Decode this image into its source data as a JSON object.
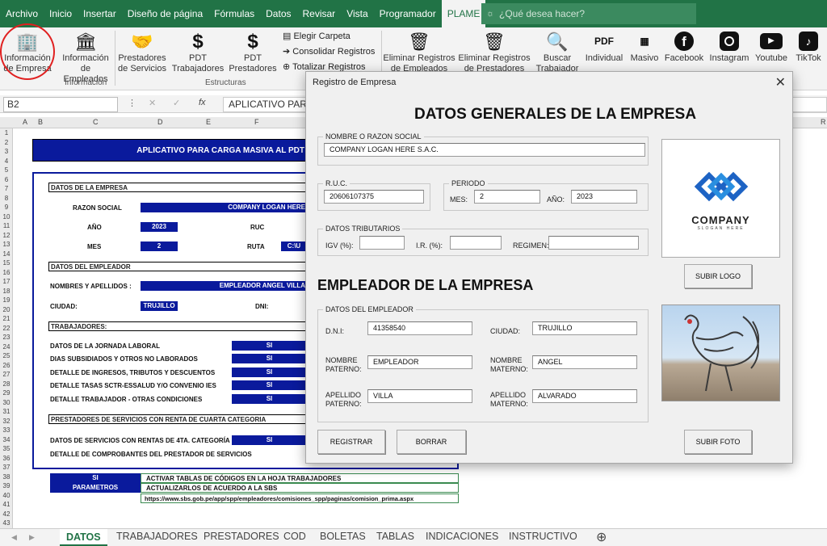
{
  "menu": {
    "tabs": [
      "Archivo",
      "Inicio",
      "Insertar",
      "Diseño de página",
      "Fórmulas",
      "Datos",
      "Revisar",
      "Vista",
      "Programador",
      "PLAME"
    ],
    "search_placeholder": "¿Qué desea hacer?"
  },
  "ribbon": {
    "buttons": [
      {
        "line1": "Información",
        "line2": "de Empresa",
        "icon": "building-icon"
      },
      {
        "line1": "Información",
        "line2": "de Empleados",
        "icon": "office-building-icon"
      },
      {
        "line1": "Prestadores",
        "line2": "de Servicios",
        "icon": "handshake-icon"
      },
      {
        "line1": "PDT",
        "line2": "Trabajadores",
        "icon": "sunat-icon"
      },
      {
        "line1": "PDT",
        "line2": "Prestadores",
        "icon": "sunat-icon"
      },
      {
        "line1": "Eliminar Registros",
        "line2": "de Empleados",
        "icon": "trash-icon"
      },
      {
        "line1": "Eliminar Registros",
        "line2": "de Prestadores",
        "icon": "trash-icon"
      },
      {
        "line1": "Buscar",
        "line2": "Trabajador",
        "icon": "search-document-icon"
      },
      {
        "line1": "Individual",
        "line2": "",
        "icon": "pdf-icon"
      },
      {
        "line1": "Masivo",
        "line2": "",
        "icon": "pdf-stack-icon"
      },
      {
        "line1": "Facebook",
        "line2": "",
        "icon": "facebook-icon"
      },
      {
        "line1": "Instagram",
        "line2": "",
        "icon": "instagram-icon"
      },
      {
        "line1": "Youtube",
        "line2": "",
        "icon": "youtube-icon"
      },
      {
        "line1": "TikTok",
        "line2": "",
        "icon": "tiktok-icon"
      }
    ],
    "list_items": [
      "Elegir Carpeta",
      "Consolidar Registros",
      "Totalizar Registros"
    ],
    "groups": [
      "Información",
      "Estructuras"
    ]
  },
  "formula_bar": {
    "name_box": "B2",
    "fx": "fx",
    "content": "APLICATIVO PARA"
  },
  "columns": [
    "A",
    "B",
    "C",
    "D",
    "E",
    "F",
    "R"
  ],
  "rows": [
    "1",
    "2",
    "3",
    "4",
    "5",
    "6",
    "7",
    "8",
    "9",
    "10",
    "11",
    "12",
    "13",
    "14",
    "15",
    "16",
    "17",
    "18",
    "19",
    "20",
    "21",
    "22",
    "23",
    "24",
    "25",
    "26",
    "27",
    "28",
    "29",
    "30",
    "31",
    "32",
    "33",
    "34",
    "35",
    "36",
    "37",
    "38",
    "39",
    "40",
    "41",
    "42",
    "43"
  ],
  "sheet": {
    "title": "APLICATIVO PARA CARGA MASIVA AL PDT",
    "sec_empresa": "DATOS DE LA EMPRESA",
    "razon_label": "RAZON SOCIAL",
    "razon_value": "COMPANY LOGAN HERE",
    "anio_label": "AÑO",
    "anio_value": "2023",
    "ruc_label": "RUC",
    "mes_label": "MES",
    "mes_value": "2",
    "ruta_label": "RUTA",
    "ruta_value": "C:\\U",
    "sec_empleador": "DATOS DEL EMPLEADOR",
    "nombres_label": "NOMBRES Y APELLIDOS :",
    "nombres_value": "EMPLEADOR ANGEL VILLA",
    "ciudad_label": "CIUDAD:",
    "ciudad_value": "TRUJILLO",
    "dni_label": "DNI:",
    "sec_trabajadores": "TRABAJADORES:",
    "trab_items": [
      "DATOS DE LA JORNADA LABORAL",
      "DIAS SUBSIDIADOS Y OTROS NO LABORADOS",
      "DETALLE DE INGRESOS, TRIBUTOS Y DESCUENTOS",
      "DETALLE TASAS SCTR-ESSALUD Y/O CONVENIO IES",
      "DETALLE TRABAJADOR - OTRAS CONDICIONES"
    ],
    "si": "SI",
    "sec_prestadores": "PRESTADORES DE SERVICIOS CON RENTA DE CUARTA CATEGORIA",
    "prest_items": [
      "DATOS DE SERVICIOS CON RENTAS DE 4TA. CATEGORÍA",
      "DETALLE DE COMPROBANTES DEL PRESTADOR DE SERVICIOS"
    ],
    "legend_si": "SI",
    "legend_si_text": "ACTIVAR TABLAS DE CÓDIGOS EN LA HOJA TRABAJADORES",
    "legend_param": "PARAMETROS",
    "legend_param_text": "ACTUALIZARLOS DE ACUERDO A LA SBS",
    "legend_url": "https://www.sbs.gob.pe/app/spp/empleadores/comisiones_spp/paginas/comision_prima.aspx"
  },
  "sheet_tabs": [
    "DATOS",
    "TRABAJADORES",
    "PRESTADORES",
    "COD",
    "BOLETAS",
    "TABLAS",
    "INDICACIONES",
    "INSTRUCTIVO"
  ],
  "dialog": {
    "title": "Registro de Empresa",
    "heading": "DATOS GENERALES DE LA EMPRESA",
    "razon_group": "NOMBRE O RAZON SOCIAL",
    "razon_value": "COMPANY LOGAN HERE S.A.C.",
    "ruc_group": "R.U.C.",
    "ruc_value": "20606107375",
    "periodo_group": "PERIODO",
    "mes_label": "MES:",
    "mes_value": "2",
    "anio_label": "AÑO:",
    "anio_value": "2023",
    "trib_group": "DATOS TRIBUTARIOS",
    "igv_label": "IGV (%):",
    "ir_label": "I.R. (%):",
    "regimen_label": "REGIMEN:",
    "logo_company": "COMPANY",
    "logo_slogan": "SLOGAN HERE",
    "subir_logo": "SUBIR LOGO",
    "empleador_heading": "EMPLEADOR DE LA EMPRESA",
    "emp_group": "DATOS DEL EMPLEADOR",
    "dni_label": "D.N.I:",
    "dni_value": "41358540",
    "ciudad_label": "CIUDAD:",
    "ciudad_value": "TRUJILLO",
    "nombre_pat_label1": "NOMBRE",
    "nombre_pat_label2": "PATERNO:",
    "nombre_pat_value": "EMPLEADOR",
    "nombre_mat_label1": "NOMBRE",
    "nombre_mat_label2": "MATERNO:",
    "nombre_mat_value": "ANGEL",
    "ape_pat_label1": "APELLIDO",
    "ape_pat_label2": "PATERNO:",
    "ape_pat_value": "VILLA",
    "ape_mat_label1": "APELLIDO",
    "ape_mat_label2": "MATERNO:",
    "ape_mat_value": "ALVARADO",
    "registrar": "REGISTRAR",
    "borrar": "BORRAR",
    "subir_foto": "SUBIR FOTO"
  }
}
